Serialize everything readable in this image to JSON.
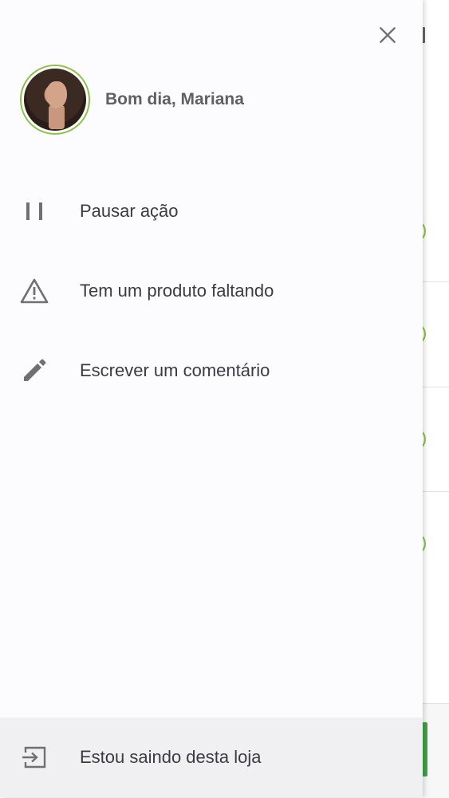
{
  "header": {
    "greeting": "Bom dia, Mariana"
  },
  "menu": {
    "items": [
      {
        "label": "Pausar ação",
        "icon": "pause-icon"
      },
      {
        "label": "Tem um produto faltando",
        "icon": "warning-icon"
      },
      {
        "label": "Escrever um comentário",
        "icon": "pencil-icon"
      }
    ]
  },
  "footer": {
    "label": "Estou saindo desta loja",
    "icon": "exit-icon"
  },
  "colors": {
    "accent": "#8bc34a",
    "drawer_background": "#fcfbfd",
    "footer_background": "#f0eff2",
    "text": "#3c3c40",
    "icon": "#707070"
  }
}
